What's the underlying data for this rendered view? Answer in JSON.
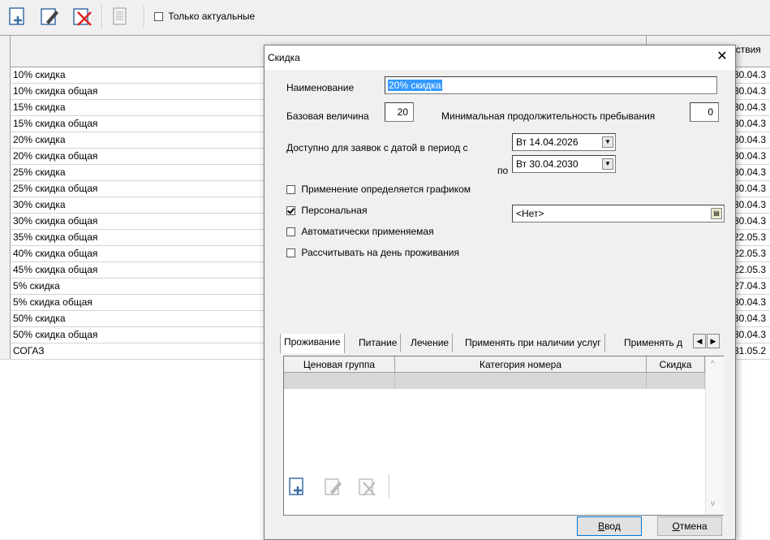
{
  "toolbar": {
    "only_current_label": "Только актуальные",
    "only_current_checked": false,
    "buttons": [
      "add-icon",
      "edit-icon",
      "delete-icon",
      "report-icon"
    ]
  },
  "grid": {
    "date_column_header": "йствия",
    "rows": [
      {
        "name": "10% скидка",
        "date": "30.04.3"
      },
      {
        "name": "10% скидка общая",
        "date": "30.04.3"
      },
      {
        "name": "15% скидка",
        "date": "30.04.3"
      },
      {
        "name": "15% скидка общая",
        "date": "30.04.3"
      },
      {
        "name": "20% скидка",
        "date": "30.04.3"
      },
      {
        "name": "20% скидка общая",
        "date": "30.04.3"
      },
      {
        "name": "25% скидка",
        "date": "30.04.3"
      },
      {
        "name": "25% скидка общая",
        "date": "30.04.3"
      },
      {
        "name": "30% скидка",
        "date": "30.04.3"
      },
      {
        "name": "30% скидка общая",
        "date": "30.04.3"
      },
      {
        "name": "35% скидка общая",
        "date": "22.05.3"
      },
      {
        "name": "40% скидка общая",
        "date": "22.05.3"
      },
      {
        "name": "45% скидка общая",
        "date": "22.05.3"
      },
      {
        "name": "5% скидка",
        "date": "27.04.3"
      },
      {
        "name": "5% скидка общая",
        "date": "30.04.3"
      },
      {
        "name": "50% скидка",
        "date": "30.04.3"
      },
      {
        "name": "50% скидка общая",
        "date": "30.04.3"
      },
      {
        "name": "СОГАЗ",
        "date": "31.05.2"
      }
    ]
  },
  "dialog": {
    "title": "Скидка",
    "close_icon": "close-icon",
    "name_label": "Наименование",
    "name_value": "20% скидка",
    "base_label": "Базовая величина",
    "base_value": "20",
    "min_stay_label": "Минимальная продолжительность пребывания",
    "min_stay_value": "0",
    "available_label": "Доступно для заявок с датой в период с",
    "to_label": "по",
    "date_from": "Вт  14.04.2026",
    "date_to": "Вт  30.04.2030",
    "options": [
      {
        "label": "Применение определяется графиком",
        "checked": false
      },
      {
        "label": "Персональная",
        "checked": true
      },
      {
        "label": "Автоматически применяемая",
        "checked": false
      },
      {
        "label": "Рассчитывать на день проживания",
        "checked": false
      }
    ],
    "personal_value": "<Нет>",
    "tabs": [
      "Проживание",
      "Питание",
      "Лечение",
      "Применять при наличии услуг",
      "Применять д"
    ],
    "active_tab": "Проживание",
    "inner_columns": [
      "Ценовая группа",
      "Категория номера",
      "Скидка"
    ],
    "ok_label": "Ввод",
    "ok_underline": "В",
    "ok_rest": "вод",
    "cancel_label": "Отмена",
    "cancel_underline": "О",
    "cancel_rest": "тмена"
  }
}
